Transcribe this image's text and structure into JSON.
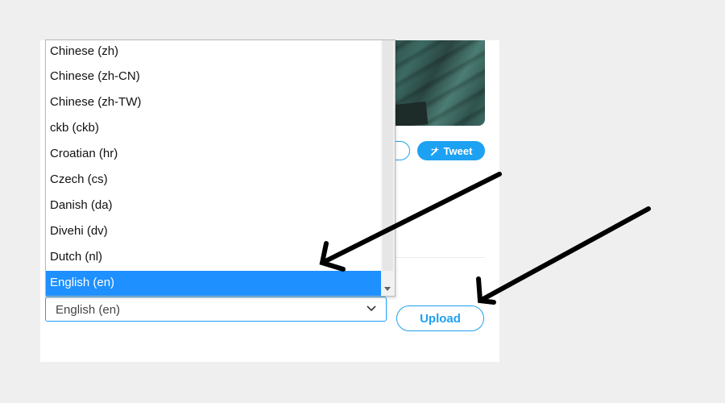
{
  "language_dropdown": {
    "options": [
      "Chinese (zh)",
      "Chinese (zh-CN)",
      "Chinese (zh-TW)",
      "ckb (ckb)",
      "Croatian (hr)",
      "Czech (cs)",
      "Danish (da)",
      "Divehi (dv)",
      "Dutch (nl)",
      "English (en)"
    ],
    "highlighted_option": "English (en)"
  },
  "language_select": {
    "selected_value": "English (en)",
    "icon": "chevron-down-icon"
  },
  "tweet_button": {
    "label": "Tweet",
    "icon": "sparkle-icon"
  },
  "upload_button": {
    "label": "Upload"
  },
  "colors": {
    "accent": "#1da1f2",
    "highlight": "#1e90ff",
    "page_background": "#efefef"
  }
}
